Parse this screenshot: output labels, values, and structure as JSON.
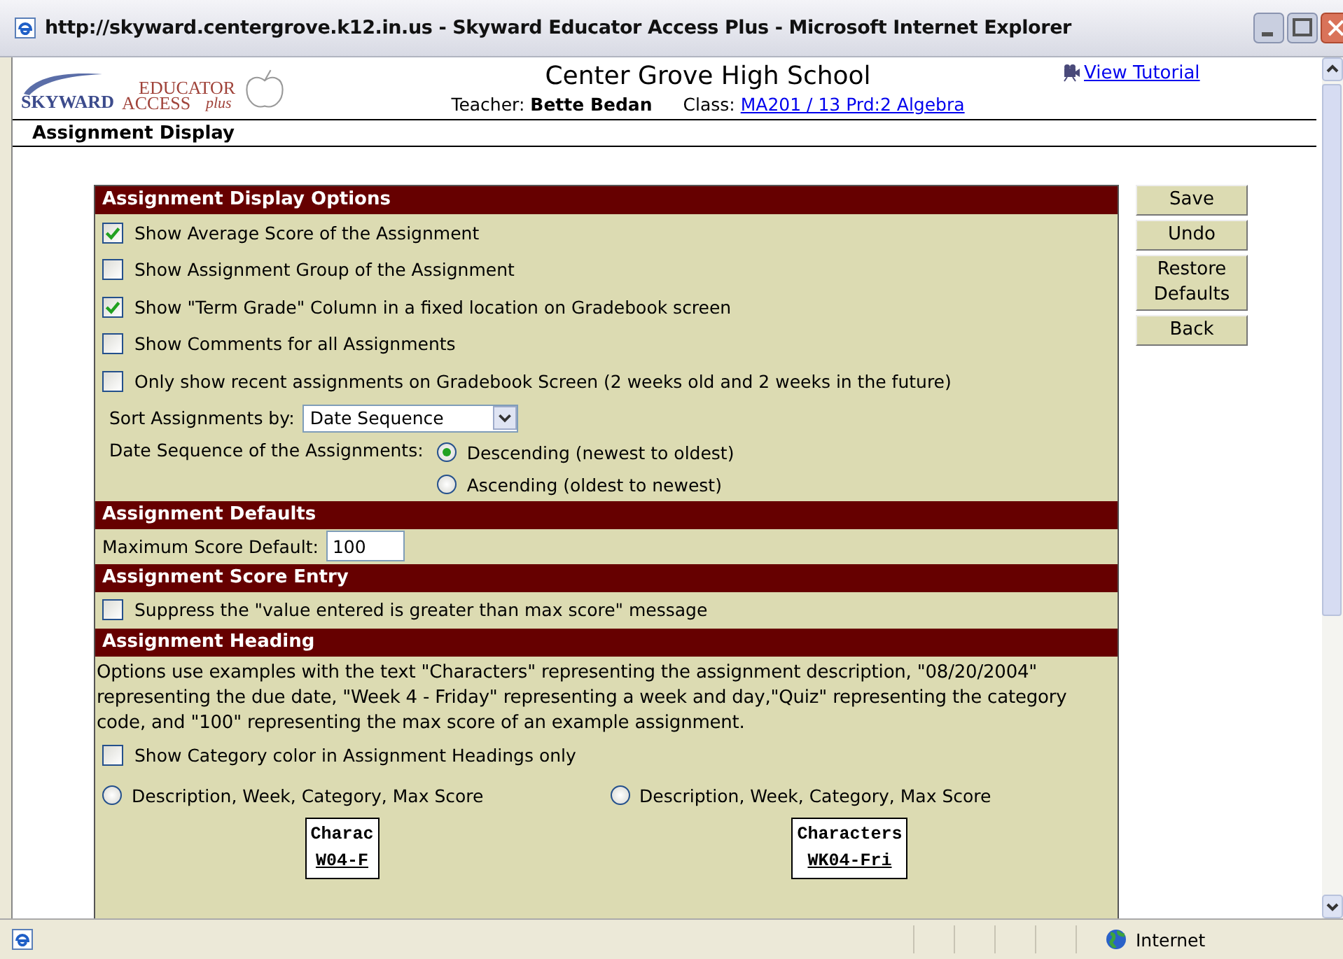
{
  "window": {
    "title": "http://skyward.centergrove.k12.in.us - Skyward Educator Access Plus - Microsoft Internet Explorer"
  },
  "header": {
    "logo_brand": "SKYWARD",
    "logo_top": "EDUCATOR",
    "logo_bottom": "ACCESS",
    "logo_plus": "plus",
    "school": "Center Grove High School",
    "teacher_label": "Teacher:",
    "teacher": "Bette Bedan",
    "class_label": "Class:",
    "class_link": "MA201 / 13 Prd:2 Algebra",
    "tutorial_link": "View Tutorial"
  },
  "page_title": "Assignment Display",
  "sections": [
    {
      "title": "Assignment Display Options",
      "items": [
        {
          "kind": "checkbox",
          "label": "Show Average Score of the Assignment",
          "checked": true
        },
        {
          "kind": "checkbox",
          "label": "Show Assignment Group of the Assignment",
          "checked": false
        },
        {
          "kind": "checkbox",
          "label": "Show \"Term Grade\" Column in a fixed location on Gradebook screen",
          "checked": true
        },
        {
          "kind": "checkbox",
          "label": "Show Comments for all Assignments",
          "checked": false
        },
        {
          "kind": "checkbox",
          "label": "Only show recent assignments on Gradebook Screen (2 weeks old and 2 weeks in the future)",
          "checked": false
        },
        {
          "kind": "select",
          "label": "Sort Assignments by:",
          "value": "Date Sequence"
        },
        {
          "kind": "radio_group",
          "label": "Date Sequence of the Assignments:",
          "options": [
            {
              "label": "Descending (newest to oldest)",
              "selected": true
            },
            {
              "label": "Ascending (oldest to newest)",
              "selected": false
            }
          ]
        }
      ]
    },
    {
      "title": "Assignment Defaults",
      "items": [
        {
          "kind": "field",
          "label": "Maximum Score Default:",
          "value": "100"
        }
      ]
    },
    {
      "title": "Assignment Score Entry",
      "items": [
        {
          "kind": "checkbox",
          "label": "Suppress the \"value entered is greater than max score\" message",
          "checked": false
        }
      ]
    },
    {
      "title": "Assignment Heading",
      "items": [
        {
          "kind": "text",
          "text": "Options use examples with the text \"Characters\" representing the assignment description, \"08/20/2004\" representing the due date, \"Week 4 - Friday\" representing a week and day,\"Quiz\" representing the category code, and \"100\" representing the max score of an example assignment."
        },
        {
          "kind": "checkbox",
          "label": "Show Category color in Assignment Headings only",
          "checked": false
        },
        {
          "kind": "radio_pair",
          "options": [
            {
              "label": "Description, Week, Category, Max Score",
              "selected": false,
              "sample": {
                "description": "Charac",
                "week": "W04-F"
              }
            },
            {
              "label": "Description, Week, Category, Max Score",
              "selected": false,
              "sample": {
                "description": "Characters",
                "week": "WK04-Fri"
              }
            }
          ]
        }
      ]
    }
  ],
  "buttons": [
    "Save",
    "Undo",
    "Restore Defaults",
    "Back"
  ],
  "status_bar": {
    "zone": "Internet"
  }
}
